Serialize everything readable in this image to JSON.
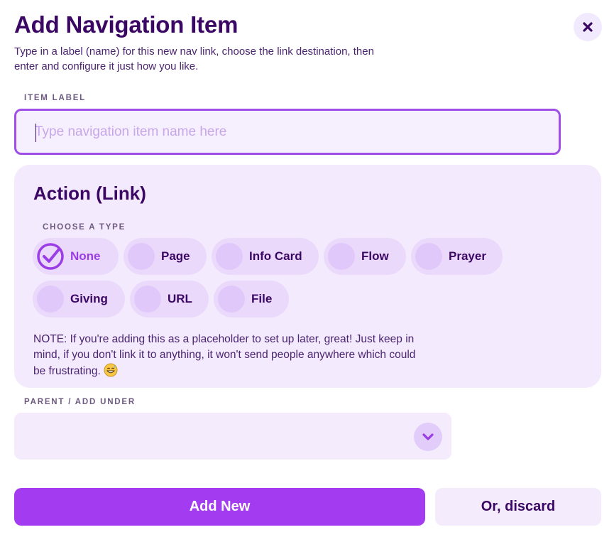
{
  "header": {
    "title": "Add Navigation Item",
    "subtitle": "Type in a label (name) for this new nav link, choose the link destination, then enter and configure it just how you like."
  },
  "close_icon": "close-icon",
  "item_label": {
    "label": "ITEM LABEL",
    "value": "",
    "placeholder": "Type navigation item name here"
  },
  "action": {
    "title": "Action (Link)",
    "choose_label": "CHOOSE A TYPE",
    "types": [
      {
        "label": "None",
        "selected": true
      },
      {
        "label": "Page",
        "selected": false
      },
      {
        "label": "Info Card",
        "selected": false
      },
      {
        "label": "Flow",
        "selected": false
      },
      {
        "label": "Prayer",
        "selected": false
      },
      {
        "label": "Giving",
        "selected": false
      },
      {
        "label": "URL",
        "selected": false
      },
      {
        "label": "File",
        "selected": false
      }
    ],
    "note": "NOTE: If you're adding this as a placeholder to set up later, great! Just keep in mind, if you don't link it to anything, it won't send people anywhere which could be frustrating.",
    "note_emoji": "grinning-sweat-emoji"
  },
  "parent": {
    "label": "PARENT / ADD UNDER",
    "value": ""
  },
  "buttons": {
    "add_new": "Add New",
    "discard": "Or, discard"
  },
  "colors": {
    "accent": "#a33cf0",
    "heading": "#3b0764",
    "card_bg": "#f3ebfd",
    "chip_bg": "#ead9fb"
  }
}
